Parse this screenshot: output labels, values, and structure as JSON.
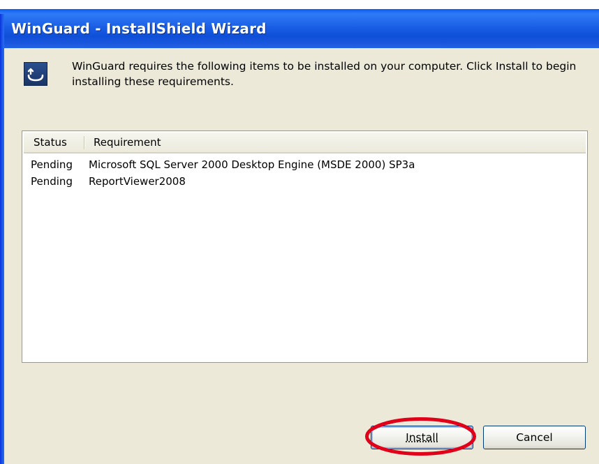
{
  "window": {
    "title": "WinGuard - InstallShield Wizard"
  },
  "header": {
    "message": "WinGuard requires the following items to be installed on your computer. Click Install to begin installing these requirements.",
    "icon": "installshield-icon"
  },
  "requirements_list": {
    "columns": [
      "Status",
      "Requirement"
    ],
    "rows": [
      {
        "status": "Pending",
        "requirement": "Microsoft SQL Server 2000 Desktop Engine (MSDE 2000) SP3a"
      },
      {
        "status": "Pending",
        "requirement": "ReportViewer2008"
      }
    ]
  },
  "buttons": {
    "install_label": "Install",
    "cancel_label": "Cancel"
  },
  "colors": {
    "titlebar_blue": "#0f4fd8",
    "dialog_background": "#ece9d8",
    "highlight_red": "#e0001a"
  }
}
